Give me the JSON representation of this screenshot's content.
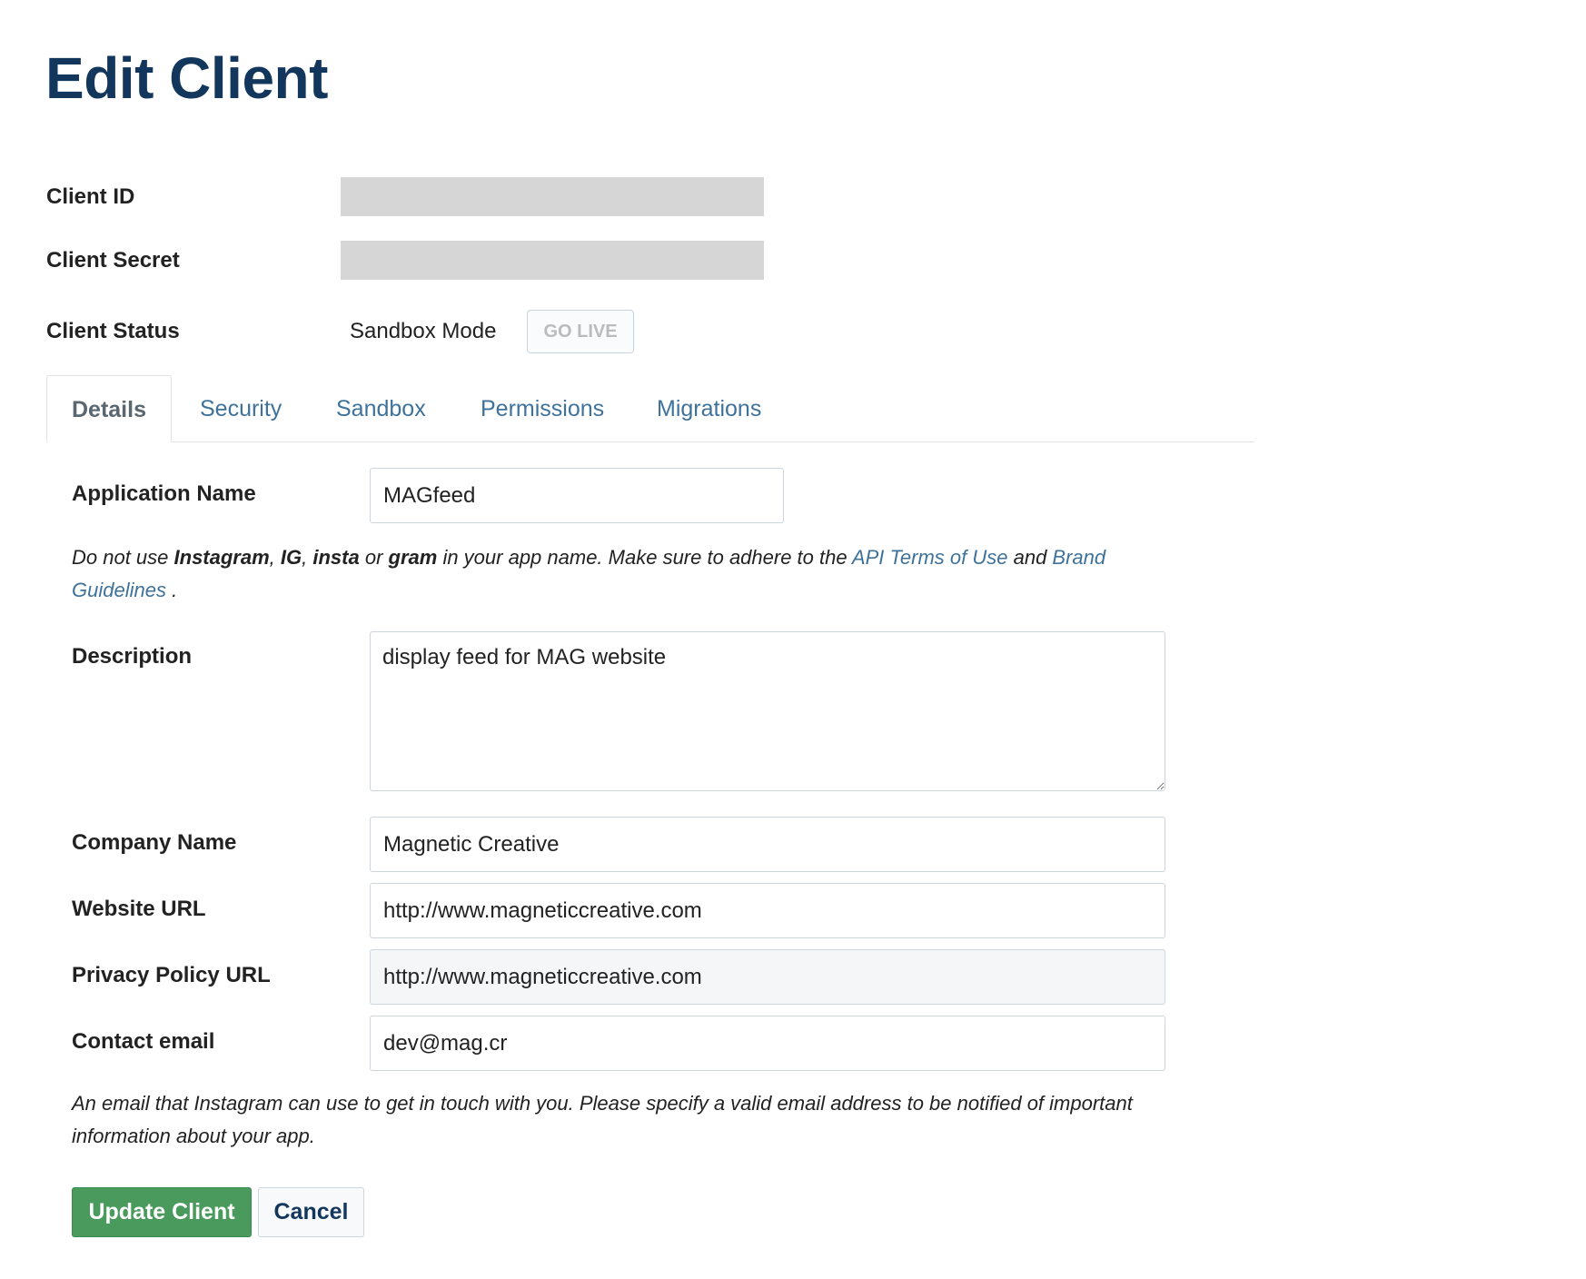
{
  "page": {
    "title": "Edit Client"
  },
  "meta": {
    "client_id_label": "Client ID",
    "client_secret_label": "Client Secret",
    "client_status_label": "Client Status",
    "status_value": "Sandbox Mode",
    "go_live_label": "GO LIVE"
  },
  "tabs": [
    {
      "label": "Details",
      "active": true
    },
    {
      "label": "Security"
    },
    {
      "label": "Sandbox"
    },
    {
      "label": "Permissions"
    },
    {
      "label": "Migrations"
    }
  ],
  "form": {
    "app_name": {
      "label": "Application Name",
      "value": "MAGfeed"
    },
    "app_name_help": {
      "t1": "Do not use ",
      "b1": "Instagram",
      "t2": ", ",
      "b2": "IG",
      "t3": ", ",
      "b3": "insta",
      "t4": " or ",
      "b4": "gram",
      "t5": " in your app name. Make sure to adhere to the ",
      "link1": "API Terms of Use",
      "t6": " and ",
      "link2": "Brand Guidelines",
      "t7": " ."
    },
    "description": {
      "label": "Description",
      "value": "display feed for MAG website"
    },
    "company_name": {
      "label": "Company Name",
      "value": "Magnetic Creative"
    },
    "website_url": {
      "label": "Website URL",
      "value": "http://www.magneticcreative.com"
    },
    "privacy_url": {
      "label": "Privacy Policy URL",
      "value": "http://www.magneticcreative.com"
    },
    "contact_email": {
      "label": "Contact email",
      "value": "dev@mag.cr"
    },
    "email_help": "An email that Instagram can use to get in touch with you. Please specify a valid email address to be notified of important information about your app."
  },
  "actions": {
    "update_label": "Update Client",
    "cancel_label": "Cancel"
  },
  "colors": {
    "title": "#12365c",
    "link": "#3f729b",
    "primary_button": "#4a9a5d"
  }
}
